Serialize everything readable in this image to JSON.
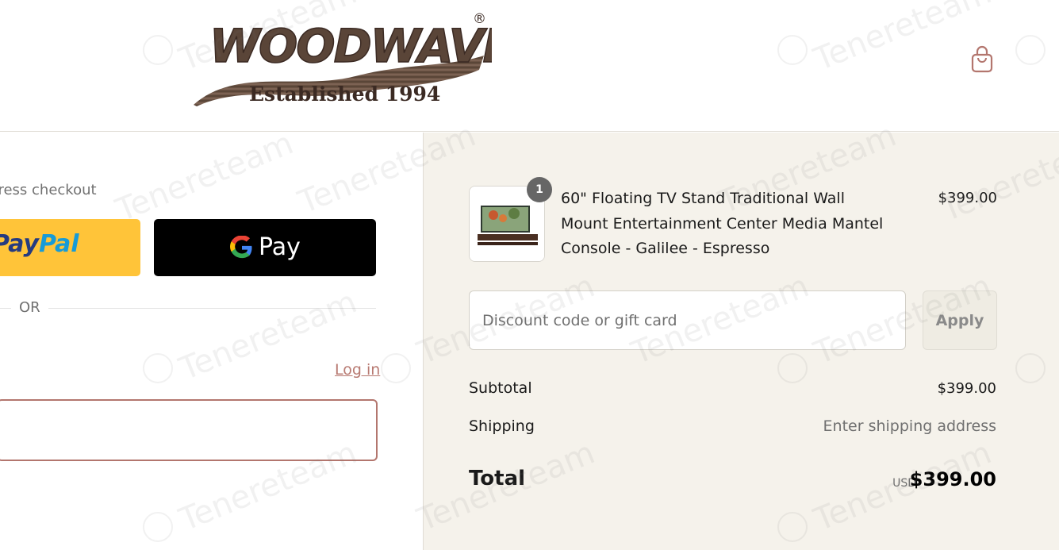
{
  "header": {
    "logo_word": "WOODWAVES",
    "logo_tagline": "Established 1994",
    "logo_mark": "®",
    "cart_icon": "shopping-bag-icon"
  },
  "express": {
    "label": "Express checkout",
    "paypal_first": "Pay",
    "paypal_second": "Pal",
    "gpay_label": "Pay",
    "gpay_icon": "google-g-icon"
  },
  "divider": {
    "label": "OR"
  },
  "contact": {
    "login_label": "Log in",
    "email_value": ""
  },
  "order": {
    "item": {
      "quantity": "1",
      "title": "60\" Floating TV Stand Traditional Wall Mount Entertainment Center Media Mantel Console - Galilee - Espresso",
      "price": "$399.00"
    },
    "discount": {
      "placeholder": "Discount code or gift card",
      "value": "",
      "apply_label": "Apply"
    },
    "subtotal": {
      "label": "Subtotal",
      "value": "$399.00"
    },
    "shipping": {
      "label": "Shipping",
      "value": "Enter shipping address"
    },
    "total": {
      "label": "Total",
      "currency": "USD",
      "value": "$399.00"
    }
  },
  "watermark": {
    "text": "Tenereteam"
  },
  "colors": {
    "accent": "#b3766e",
    "sidebar_bg": "#f5f2eb",
    "paypal_yellow": "#ffc439",
    "gpay_black": "#000000"
  }
}
